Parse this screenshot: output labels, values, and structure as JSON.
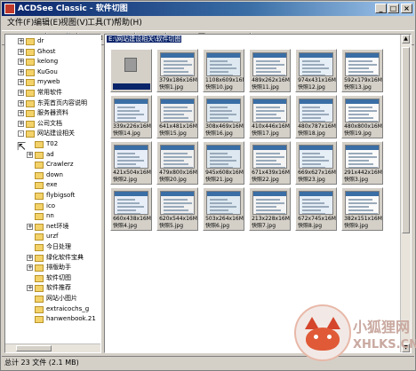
{
  "window": {
    "title": "ACDSee Classic - 软件切图"
  },
  "menu": [
    "文件(F)",
    "编辑(E)",
    "视图(V)",
    "工具(T)",
    "帮助(H)"
  ],
  "toolbar_icons": [
    "back-icon",
    "forward-icon",
    "up-folder-icon",
    "refresh-icon",
    "sort-icon",
    "view-mode-icon",
    "print-icon",
    "copy-icon",
    "move-icon",
    "delete-icon",
    "rename-icon",
    "properties-icon",
    "browse-icon",
    "thumbnail-icon",
    "list-icon",
    "details-icon",
    "slideshow-icon",
    "wallpaper-icon",
    "help-icon"
  ],
  "address": "E:\\网站建设相关\\软件切图",
  "tree": [
    {
      "label": "dr",
      "level": 1,
      "exp": "+"
    },
    {
      "label": "Ghost",
      "level": 1,
      "exp": "+"
    },
    {
      "label": "kelong",
      "level": 1,
      "exp": "+"
    },
    {
      "label": "KuGou",
      "level": 1,
      "exp": "+"
    },
    {
      "label": "myweb",
      "level": 1,
      "exp": "+"
    },
    {
      "label": "常用软件",
      "level": 1,
      "exp": "+"
    },
    {
      "label": "东莞首页内容说明",
      "level": 1,
      "exp": "+"
    },
    {
      "label": "服务器资料",
      "level": 1,
      "exp": "+"
    },
    {
      "label": "公司文档",
      "level": 1,
      "exp": "+"
    },
    {
      "label": "网站建设相关",
      "level": 1,
      "exp": "-"
    },
    {
      "label": "T02",
      "level": 2,
      "exp": ""
    },
    {
      "label": "ad",
      "level": 2,
      "exp": "+"
    },
    {
      "label": "Crawlerz",
      "level": 2,
      "exp": ""
    },
    {
      "label": "down",
      "level": 2,
      "exp": ""
    },
    {
      "label": "exe",
      "level": 2,
      "exp": ""
    },
    {
      "label": "flybigsoft",
      "level": 2,
      "exp": ""
    },
    {
      "label": "ico",
      "level": 2,
      "exp": ""
    },
    {
      "label": "nn",
      "level": 2,
      "exp": ""
    },
    {
      "label": "net环境",
      "level": 2,
      "exp": "+"
    },
    {
      "label": "urzf",
      "level": 2,
      "exp": ""
    },
    {
      "label": "今日处理",
      "level": 2,
      "exp": ""
    },
    {
      "label": "绿化软件宝典",
      "level": 2,
      "exp": "+"
    },
    {
      "label": "排版助手",
      "level": 2,
      "exp": "+"
    },
    {
      "label": "软件切图",
      "level": 2,
      "exp": ""
    },
    {
      "label": "软件推荐",
      "level": 2,
      "exp": "+"
    },
    {
      "label": "网站小图片",
      "level": 2,
      "exp": ""
    },
    {
      "label": "extraicochs_g",
      "level": 2,
      "exp": ""
    },
    {
      "label": "hanwenbook.21",
      "level": 2,
      "exp": ""
    }
  ],
  "files": [
    {
      "size": "",
      "name": ""
    },
    {
      "size": "379x186x16M",
      "name": "快照1.jpg"
    },
    {
      "size": "1108x609x16M",
      "name": "快照10.jpg"
    },
    {
      "size": "489x262x16M",
      "name": "快照11.jpg"
    },
    {
      "size": "974x431x16M",
      "name": "快照12.jpg"
    },
    {
      "size": "592x179x16M",
      "name": "快照13.jpg"
    },
    {
      "size": "339x226x16M",
      "name": "快照14.jpg"
    },
    {
      "size": "641x481x16M",
      "name": "快照15.jpg"
    },
    {
      "size": "308x469x16M",
      "name": "快照16.jpg"
    },
    {
      "size": "410x446x16M",
      "name": "快照17.jpg"
    },
    {
      "size": "480x787x16M",
      "name": "快照18.jpg"
    },
    {
      "size": "480x800x16M",
      "name": "快照19.jpg"
    },
    {
      "size": "421x504x16M",
      "name": "快照2.jpg"
    },
    {
      "size": "479x800x16M",
      "name": "快照20.jpg"
    },
    {
      "size": "945x608x16M",
      "name": "快照21.jpg"
    },
    {
      "size": "671x439x16M",
      "name": "快照22.jpg"
    },
    {
      "size": "669x627x16M",
      "name": "快照23.jpg"
    },
    {
      "size": "291x442x16M",
      "name": "快照3.jpg"
    },
    {
      "size": "660x438x16M",
      "name": "快照4.jpg"
    },
    {
      "size": "620x544x16M",
      "name": "快照5.jpg"
    },
    {
      "size": "503x264x16M",
      "name": "快照6.jpg"
    },
    {
      "size": "213x228x16M",
      "name": "快照7.jpg"
    },
    {
      "size": "672x745x16M",
      "name": "快照8.jpg"
    },
    {
      "size": "382x151x16M",
      "name": "快照9.jpg"
    }
  ],
  "status": "总计 23 文件 (2.1 MB)",
  "watermark": {
    "cn": "小狐狸网",
    "url": "XHLKS.CN"
  }
}
